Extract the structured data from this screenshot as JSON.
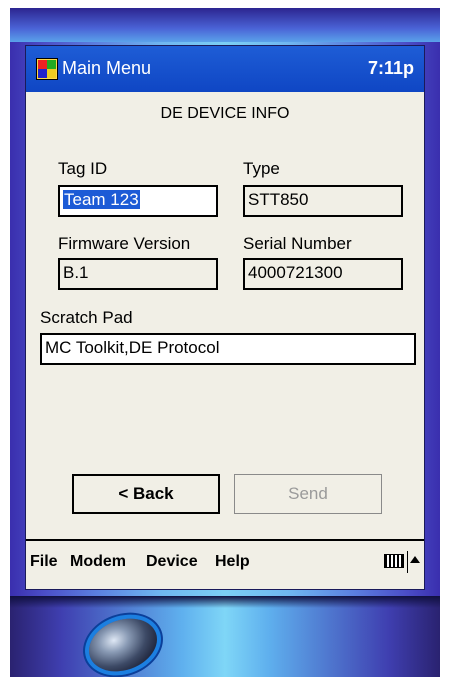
{
  "titlebar": {
    "title": "Main Menu",
    "clock": "7:11p"
  },
  "form": {
    "title": "DE DEVICE INFO",
    "tag_id": {
      "label": "Tag ID",
      "value": "Team 123"
    },
    "type": {
      "label": "Type",
      "value": "STT850"
    },
    "firmware": {
      "label": "Firmware Version",
      "value": "B.1"
    },
    "serial": {
      "label": "Serial Number",
      "value": "4000721300"
    },
    "scratch": {
      "label": "Scratch Pad",
      "value": "MC Toolkit,DE Protocol"
    }
  },
  "buttons": {
    "back": "< Back",
    "send": "Send"
  },
  "menubar": {
    "items": [
      "File",
      "Modem",
      "Device",
      "Help"
    ]
  },
  "colors": {
    "titlebar": "#1e5dd6",
    "selection": "#1c5bd6",
    "background": "#f1efe6"
  },
  "icons": {
    "start": "windows-flag-icon",
    "keyboard": "keyboard-icon",
    "sip": "up-arrow-icon"
  }
}
